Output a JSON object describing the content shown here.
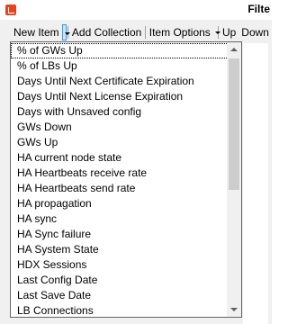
{
  "titlebar": {
    "title": "Filte",
    "app_icon": "app-logo-icon",
    "accent_color": "#e8431f"
  },
  "toolbar": {
    "new_item_label": "New Item",
    "add_collection_label": "Add Collection",
    "item_options_label": "Item Options",
    "up_label": "Up",
    "down_label": "Down"
  },
  "dropdown": {
    "items": [
      "% of GWs Up",
      "% of LBs Up",
      "Days Until Next Certificate Expiration",
      "Days Until Next License Expiration",
      "Days with Unsaved config",
      "GWs Down",
      "GWs Up",
      "HA current node state",
      "HA Heartbeats receive rate",
      "HA Heartbeats send rate",
      "HA propagation",
      "HA sync",
      "HA Sync failure",
      "HA System State",
      "HDX Sessions",
      "Last Config Date",
      "Last Save Date",
      "LB Connections"
    ],
    "focused_item": "% of GWs Up"
  }
}
